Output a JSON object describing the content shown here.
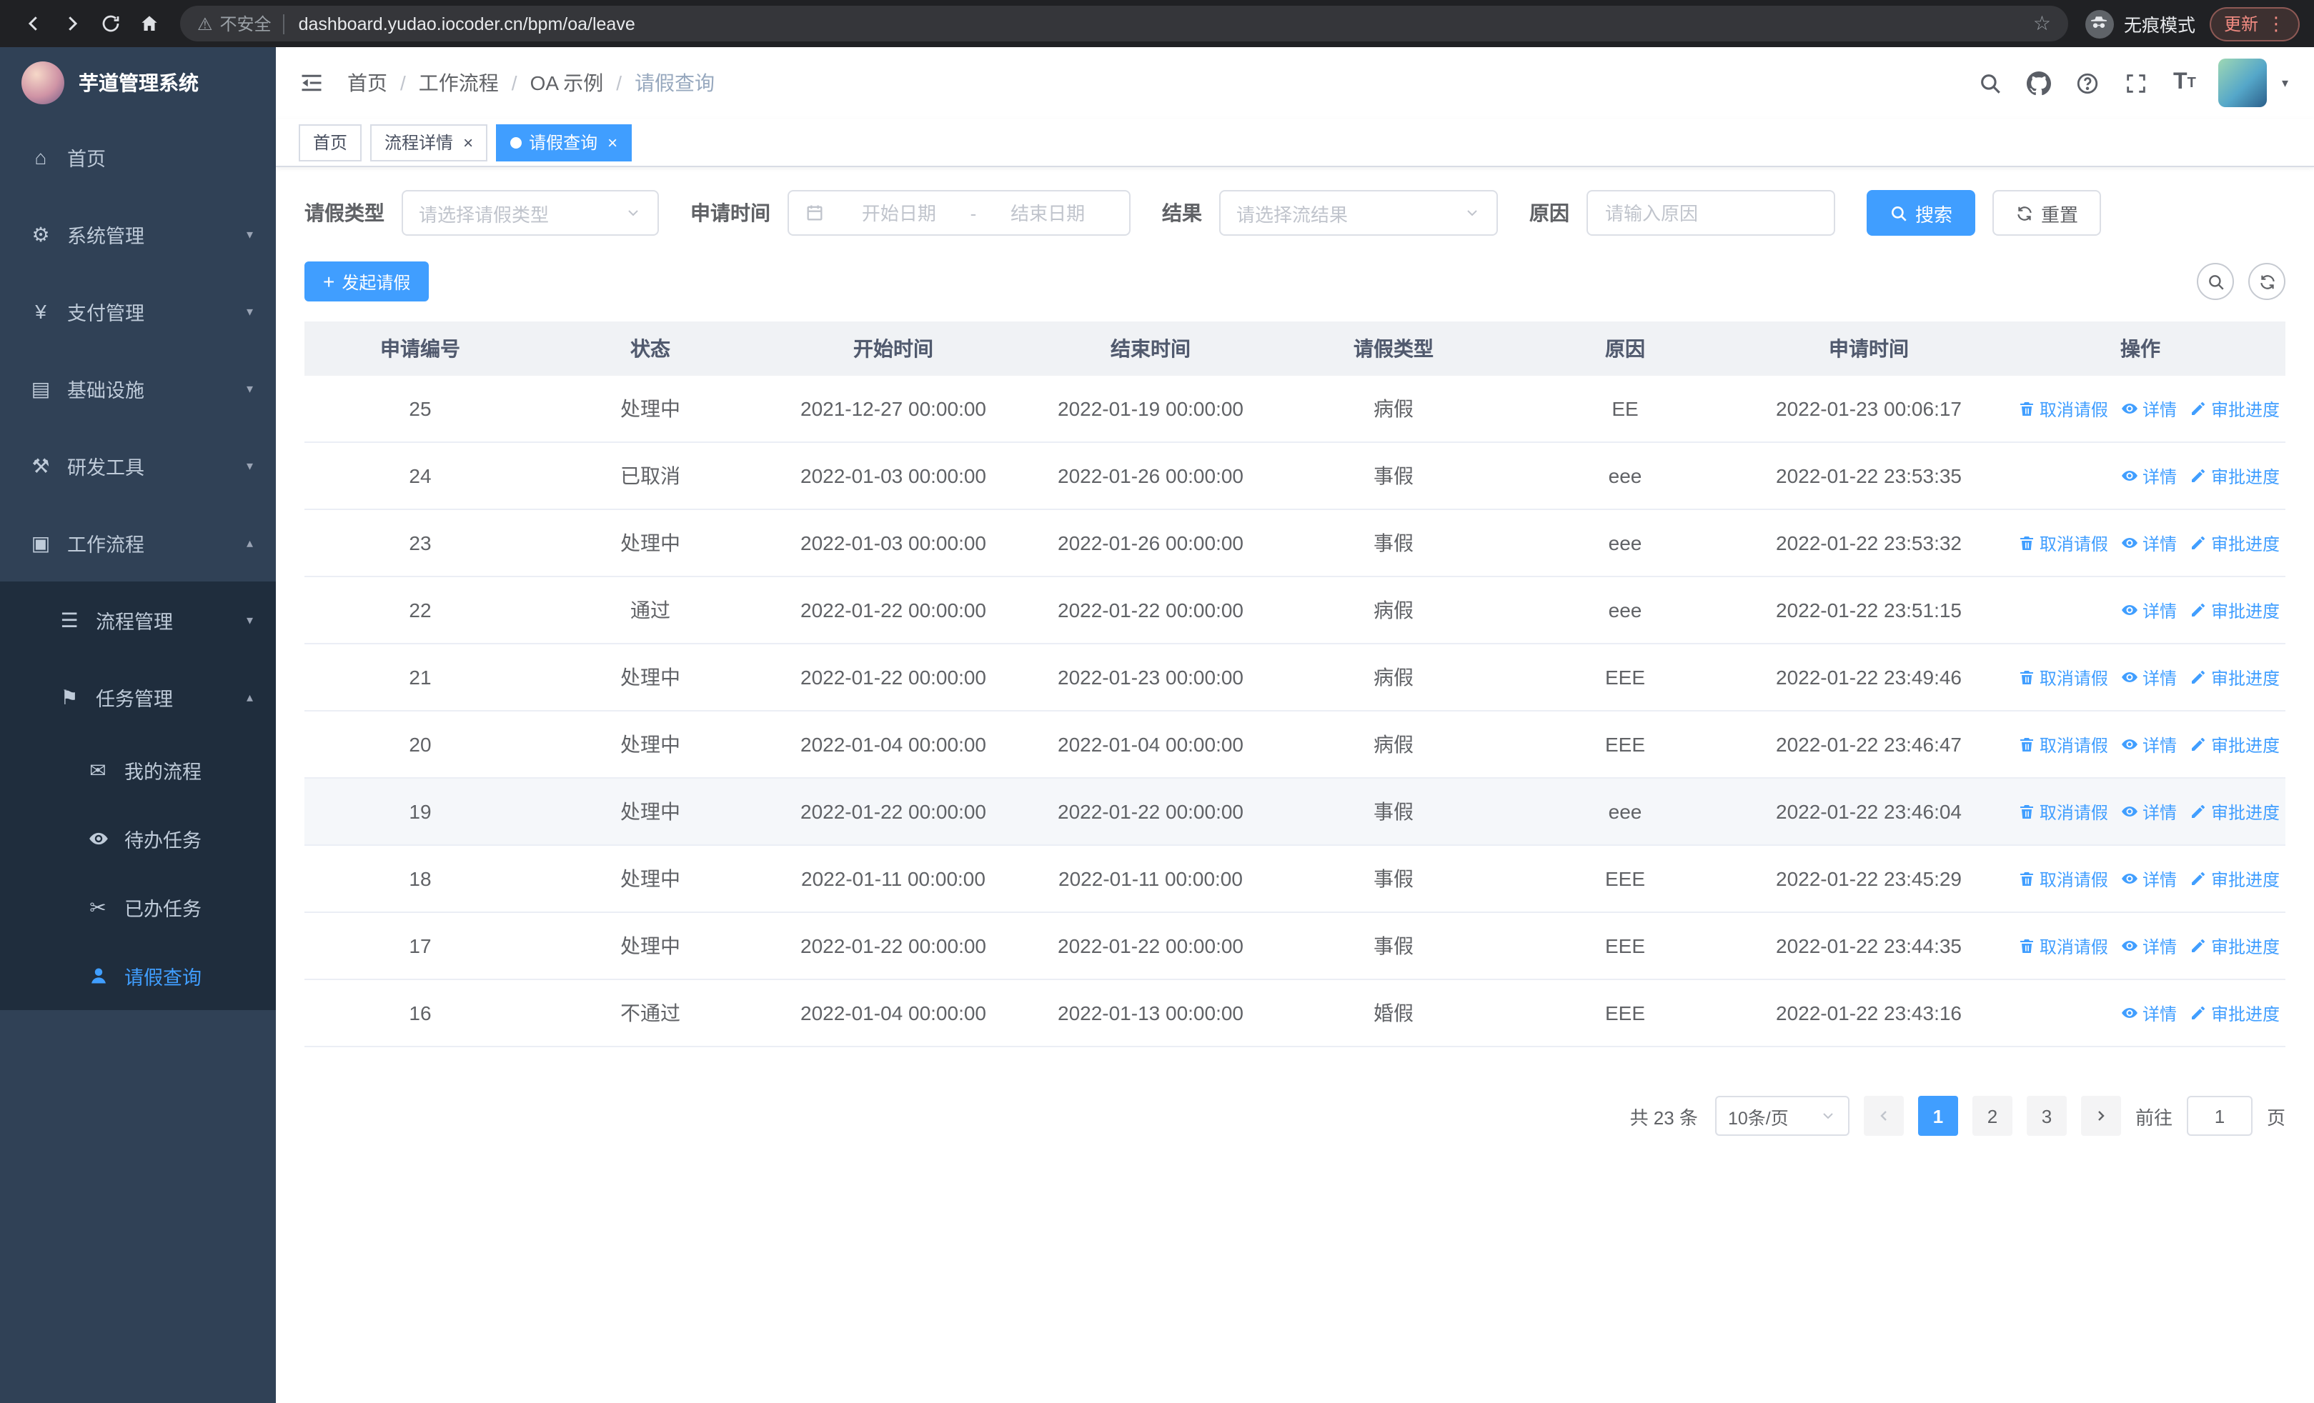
{
  "browser": {
    "security_warning": "不安全",
    "url": "dashboard.yudao.iocoder.cn/bpm/oa/leave",
    "incognito_label": "无痕模式",
    "update_label": "更新"
  },
  "sidebar": {
    "title": "芋道管理系统",
    "menu": [
      {
        "key": "home",
        "label": "首页",
        "icon": "home-icon",
        "level": 1
      },
      {
        "key": "system",
        "label": "系统管理",
        "icon": "gear-icon",
        "level": 1,
        "arrow": "down"
      },
      {
        "key": "payment",
        "label": "支付管理",
        "icon": "yen-icon",
        "level": 1,
        "arrow": "down"
      },
      {
        "key": "infrastructure",
        "label": "基础设施",
        "icon": "infra-icon",
        "level": 1,
        "arrow": "down"
      },
      {
        "key": "dev-tools",
        "label": "研发工具",
        "icon": "tools-icon",
        "level": 1,
        "arrow": "down"
      },
      {
        "key": "workflow",
        "label": "工作流程",
        "icon": "workflow-icon",
        "level": 1,
        "arrow": "up"
      },
      {
        "key": "process-management",
        "label": "流程管理",
        "icon": "process-icon",
        "level": 2,
        "arrow": "down"
      },
      {
        "key": "task-management",
        "label": "任务管理",
        "icon": "task-icon",
        "level": 2,
        "arrow": "up"
      },
      {
        "key": "my-process",
        "label": "我的流程",
        "icon": "chat-icon",
        "level": 3
      },
      {
        "key": "todo-tasks",
        "label": "待办任务",
        "icon": "eye-icon",
        "level": 3
      },
      {
        "key": "done-tasks",
        "label": "已办任务",
        "icon": "done-icon",
        "level": 3
      },
      {
        "key": "leave-query",
        "label": "请假查询",
        "icon": "user-icon",
        "level": 3,
        "active": true
      }
    ]
  },
  "header": {
    "breadcrumb": [
      "首页",
      "工作流程",
      "OA 示例",
      "请假查询"
    ]
  },
  "tabs": [
    {
      "key": "home",
      "label": "首页",
      "closable": false,
      "active": false
    },
    {
      "key": "process-detail",
      "label": "流程详情",
      "closable": true,
      "active": false
    },
    {
      "key": "leave-query",
      "label": "请假查询",
      "closable": true,
      "active": true
    }
  ],
  "filters": {
    "leave_type_label": "请假类型",
    "leave_type_placeholder": "请选择请假类型",
    "apply_time_label": "申请时间",
    "start_date_placeholder": "开始日期",
    "range_separator": "-",
    "end_date_placeholder": "结束日期",
    "result_label": "结果",
    "result_placeholder": "请选择流结果",
    "reason_label": "原因",
    "reason_placeholder": "请输入原因",
    "search_button": "搜索",
    "reset_button": "重置"
  },
  "toolbar": {
    "create_button": "发起请假"
  },
  "table": {
    "columns": [
      "申请编号",
      "状态",
      "开始时间",
      "结束时间",
      "请假类型",
      "原因",
      "申请时间",
      "操作"
    ],
    "action_labels": {
      "cancel": "取消请假",
      "detail": "详情",
      "progress": "审批进度"
    },
    "rows": [
      {
        "id": "25",
        "status": "处理中",
        "start": "2021-12-27 00:00:00",
        "end": "2022-01-19 00:00:00",
        "type": "病假",
        "reason": "EE",
        "applied": "2022-01-23 00:06:17",
        "actions": [
          "cancel",
          "detail",
          "progress"
        ]
      },
      {
        "id": "24",
        "status": "已取消",
        "start": "2022-01-03 00:00:00",
        "end": "2022-01-26 00:00:00",
        "type": "事假",
        "reason": "eee",
        "applied": "2022-01-22 23:53:35",
        "actions": [
          "detail",
          "progress"
        ]
      },
      {
        "id": "23",
        "status": "处理中",
        "start": "2022-01-03 00:00:00",
        "end": "2022-01-26 00:00:00",
        "type": "事假",
        "reason": "eee",
        "applied": "2022-01-22 23:53:32",
        "actions": [
          "cancel",
          "detail",
          "progress"
        ]
      },
      {
        "id": "22",
        "status": "通过",
        "start": "2022-01-22 00:00:00",
        "end": "2022-01-22 00:00:00",
        "type": "病假",
        "reason": "eee",
        "applied": "2022-01-22 23:51:15",
        "actions": [
          "detail",
          "progress"
        ]
      },
      {
        "id": "21",
        "status": "处理中",
        "start": "2022-01-22 00:00:00",
        "end": "2022-01-23 00:00:00",
        "type": "病假",
        "reason": "EEE",
        "applied": "2022-01-22 23:49:46",
        "actions": [
          "cancel",
          "detail",
          "progress"
        ]
      },
      {
        "id": "20",
        "status": "处理中",
        "start": "2022-01-04 00:00:00",
        "end": "2022-01-04 00:00:00",
        "type": "病假",
        "reason": "EEE",
        "applied": "2022-01-22 23:46:47",
        "actions": [
          "cancel",
          "detail",
          "progress"
        ]
      },
      {
        "id": "19",
        "status": "处理中",
        "start": "2022-01-22 00:00:00",
        "end": "2022-01-22 00:00:00",
        "type": "事假",
        "reason": "eee",
        "applied": "2022-01-22 23:46:04",
        "actions": [
          "cancel",
          "detail",
          "progress"
        ],
        "highlighted": true
      },
      {
        "id": "18",
        "status": "处理中",
        "start": "2022-01-11 00:00:00",
        "end": "2022-01-11 00:00:00",
        "type": "事假",
        "reason": "EEE",
        "applied": "2022-01-22 23:45:29",
        "actions": [
          "cancel",
          "detail",
          "progress"
        ]
      },
      {
        "id": "17",
        "status": "处理中",
        "start": "2022-01-22 00:00:00",
        "end": "2022-01-22 00:00:00",
        "type": "事假",
        "reason": "EEE",
        "applied": "2022-01-22 23:44:35",
        "actions": [
          "cancel",
          "detail",
          "progress"
        ]
      },
      {
        "id": "16",
        "status": "不通过",
        "start": "2022-01-04 00:00:00",
        "end": "2022-01-13 00:00:00",
        "type": "婚假",
        "reason": "EEE",
        "applied": "2022-01-22 23:43:16",
        "actions": [
          "detail",
          "progress"
        ]
      }
    ]
  },
  "pagination": {
    "total_text": "共 23 条",
    "page_size": "10条/页",
    "pages": [
      "1",
      "2",
      "3"
    ],
    "active_page": "1",
    "goto_label": "前往",
    "goto_value": "1",
    "goto_suffix": "页"
  }
}
